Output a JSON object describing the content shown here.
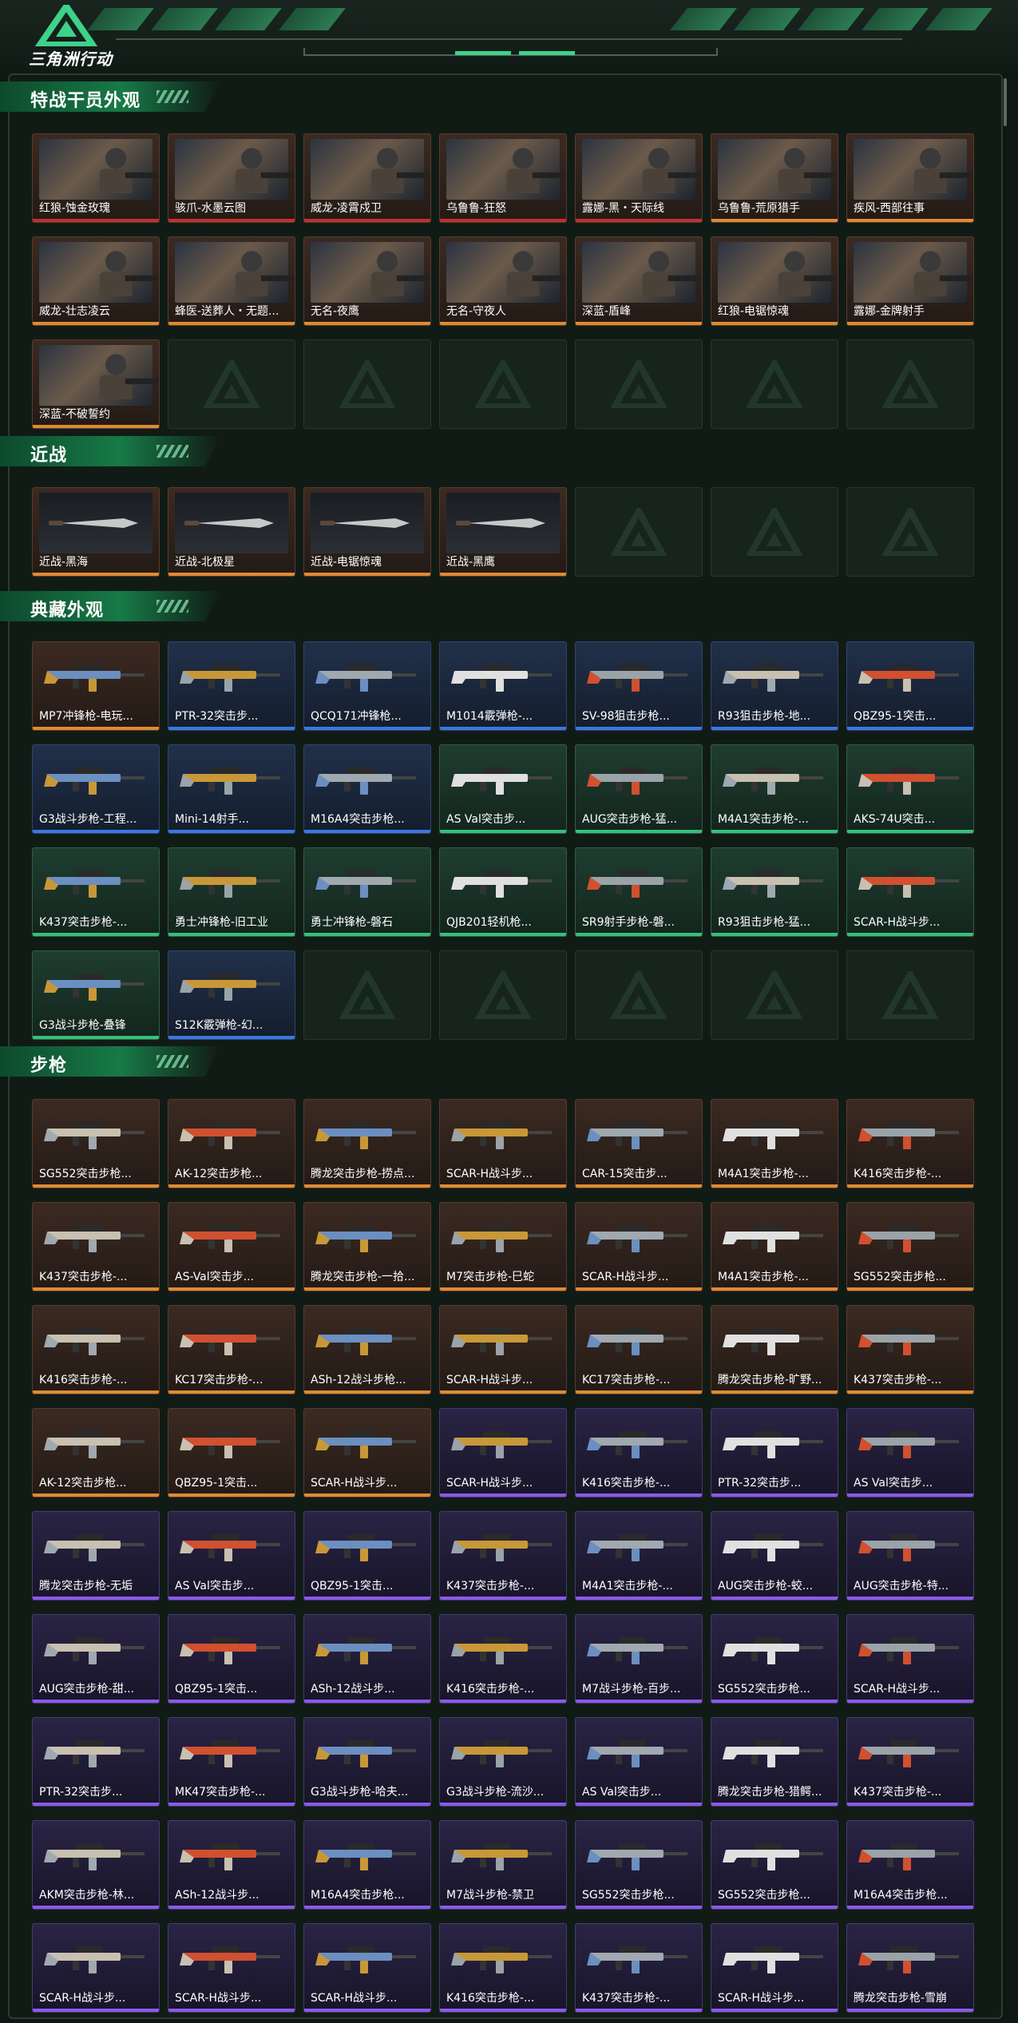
{
  "app": {
    "title": "三角洲行动"
  },
  "colors": {
    "accent": "#36c07a",
    "bg": "#0e1712",
    "legendary": "#e08a32",
    "epic": "#8a5ae8",
    "rare": "#3a78e0",
    "uncommon": "#36c07a",
    "red": "#c03030"
  },
  "sections": [
    {
      "title": "特战干员外观",
      "kind": "agent",
      "items": [
        {
          "label": "红狼-蚀金玫瑰",
          "rarity": "red"
        },
        {
          "label": "骇爪-水墨云图",
          "rarity": "red"
        },
        {
          "label": "威龙-凌霄戍卫",
          "rarity": "red"
        },
        {
          "label": "乌鲁鲁-狂怒",
          "rarity": "red"
        },
        {
          "label": "露娜-黑・天际线",
          "rarity": "red"
        },
        {
          "label": "乌鲁鲁-荒原猎手",
          "rarity": "orange"
        },
        {
          "label": "疾风-西部往事",
          "rarity": "orange"
        },
        {
          "label": "威龙-壮志凌云",
          "rarity": "orange"
        },
        {
          "label": "蜂医-送葬人・无题...",
          "rarity": "orange"
        },
        {
          "label": "无名-夜鹰",
          "rarity": "orange"
        },
        {
          "label": "无名-守夜人",
          "rarity": "orange"
        },
        {
          "label": "深蓝-盾峰",
          "rarity": "orange"
        },
        {
          "label": "红狼-电锯惊魂",
          "rarity": "orange"
        },
        {
          "label": "露娜-金牌射手",
          "rarity": "orange"
        },
        {
          "label": "深蓝-不破誓约",
          "rarity": "orange"
        }
      ],
      "empty": 6
    },
    {
      "title": "近战",
      "kind": "melee",
      "items": [
        {
          "label": "近战-黑海",
          "rarity": "orange"
        },
        {
          "label": "近战-北极星",
          "rarity": "orange"
        },
        {
          "label": "近战-电锯惊魂",
          "rarity": "orange"
        },
        {
          "label": "近战-黑鹰",
          "rarity": "orange"
        }
      ],
      "empty": 3
    },
    {
      "title": "典藏外观",
      "kind": "gun",
      "items": [
        {
          "label": "MP7冲锋枪-电玩...",
          "rarity": "brown"
        },
        {
          "label": "PTR-32突击步...",
          "rarity": "blue"
        },
        {
          "label": "QCQ171冲锋枪...",
          "rarity": "blue"
        },
        {
          "label": "M1014霰弹枪-...",
          "rarity": "blue"
        },
        {
          "label": "SV-98狙击步枪...",
          "rarity": "blue"
        },
        {
          "label": "R93狙击步枪-地...",
          "rarity": "blue"
        },
        {
          "label": "QBZ95-1突击...",
          "rarity": "blue"
        },
        {
          "label": "G3战斗步枪-工程...",
          "rarity": "blue"
        },
        {
          "label": "Mini-14射手...",
          "rarity": "blue"
        },
        {
          "label": "M16A4突击步枪...",
          "rarity": "blue"
        },
        {
          "label": "AS Val突击步...",
          "rarity": "green"
        },
        {
          "label": "AUG突击步枪-猛...",
          "rarity": "green"
        },
        {
          "label": "M4A1突击步枪-...",
          "rarity": "green"
        },
        {
          "label": "AKS-74U突击...",
          "rarity": "green"
        },
        {
          "label": "K437突击步枪-...",
          "rarity": "green"
        },
        {
          "label": "勇士冲锋枪-旧工业",
          "rarity": "green"
        },
        {
          "label": "勇士冲锋枪-磐石",
          "rarity": "green"
        },
        {
          "label": "QJB201轻机枪...",
          "rarity": "green"
        },
        {
          "label": "SR9射手步枪-磐...",
          "rarity": "green"
        },
        {
          "label": "R93狙击步枪-猛...",
          "rarity": "green"
        },
        {
          "label": "SCAR-H战斗步...",
          "rarity": "green"
        },
        {
          "label": "G3战斗步枪-叠锋",
          "rarity": "green"
        },
        {
          "label": "S12K霰弹枪-幻...",
          "rarity": "blue"
        }
      ],
      "empty": 5
    },
    {
      "title": "步枪",
      "kind": "gun",
      "items": [
        {
          "label": "SG552突击步枪...",
          "rarity": "brown"
        },
        {
          "label": "AK-12突击步枪...",
          "rarity": "brown"
        },
        {
          "label": "腾龙突击步枪-捞点...",
          "rarity": "brown"
        },
        {
          "label": "SCAR-H战斗步...",
          "rarity": "brown"
        },
        {
          "label": "CAR-15突击步...",
          "rarity": "brown"
        },
        {
          "label": "M4A1突击步枪-...",
          "rarity": "brown"
        },
        {
          "label": "K416突击步枪-...",
          "rarity": "brown"
        },
        {
          "label": "K437突击步枪-...",
          "rarity": "brown"
        },
        {
          "label": "AS-Val突击步...",
          "rarity": "brown"
        },
        {
          "label": "腾龙突击步枪-一拾...",
          "rarity": "brown"
        },
        {
          "label": "M7突击步枪-巳蛇",
          "rarity": "brown"
        },
        {
          "label": "SCAR-H战斗步...",
          "rarity": "brown"
        },
        {
          "label": "M4A1突击步枪-...",
          "rarity": "brown"
        },
        {
          "label": "SG552突击步枪...",
          "rarity": "brown"
        },
        {
          "label": "K416突击步枪-...",
          "rarity": "brown"
        },
        {
          "label": "KC17突击步枪-...",
          "rarity": "brown"
        },
        {
          "label": "ASh-12战斗步枪...",
          "rarity": "brown"
        },
        {
          "label": "SCAR-H战斗步...",
          "rarity": "brown"
        },
        {
          "label": "KC17突击步枪-...",
          "rarity": "brown"
        },
        {
          "label": "腾龙突击步枪-旷野...",
          "rarity": "brown"
        },
        {
          "label": "K437突击步枪-...",
          "rarity": "brown"
        },
        {
          "label": "AK-12突击步枪...",
          "rarity": "brown"
        },
        {
          "label": "QBZ95-1突击...",
          "rarity": "brown"
        },
        {
          "label": "SCAR-H战斗步...",
          "rarity": "brown"
        },
        {
          "label": "SCAR-H战斗步...",
          "rarity": "purple"
        },
        {
          "label": "K416突击步枪-...",
          "rarity": "purple"
        },
        {
          "label": "PTR-32突击步...",
          "rarity": "purple"
        },
        {
          "label": "AS Val突击步...",
          "rarity": "purple"
        },
        {
          "label": "腾龙突击步枪-无垢",
          "rarity": "purple"
        },
        {
          "label": "AS Val突击步...",
          "rarity": "purple"
        },
        {
          "label": "QBZ95-1突击...",
          "rarity": "purple"
        },
        {
          "label": "K437突击步枪-...",
          "rarity": "purple"
        },
        {
          "label": "M4A1突击步枪-...",
          "rarity": "purple"
        },
        {
          "label": "AUG突击步枪-蛟...",
          "rarity": "purple"
        },
        {
          "label": "AUG突击步枪-特...",
          "rarity": "purple"
        },
        {
          "label": "AUG突击步枪-甜...",
          "rarity": "purple"
        },
        {
          "label": "QBZ95-1突击...",
          "rarity": "purple"
        },
        {
          "label": "ASh-12战斗步...",
          "rarity": "purple"
        },
        {
          "label": "K416突击步枪-...",
          "rarity": "purple"
        },
        {
          "label": "M7战斗步枪-百步...",
          "rarity": "purple"
        },
        {
          "label": "SG552突击步枪...",
          "rarity": "purple"
        },
        {
          "label": "SCAR-H战斗步...",
          "rarity": "purple"
        },
        {
          "label": "PTR-32突击步...",
          "rarity": "purple"
        },
        {
          "label": "MK47突击步枪-...",
          "rarity": "purple"
        },
        {
          "label": "G3战斗步枪-哈夫...",
          "rarity": "purple"
        },
        {
          "label": "G3战斗步枪-流沙...",
          "rarity": "purple"
        },
        {
          "label": "AS Val突击步...",
          "rarity": "purple"
        },
        {
          "label": "腾龙突击步枪-猎鳄...",
          "rarity": "purple"
        },
        {
          "label": "K437突击步枪-...",
          "rarity": "purple"
        },
        {
          "label": "AKM突击步枪-林...",
          "rarity": "purple"
        },
        {
          "label": "ASh-12战斗步...",
          "rarity": "purple"
        },
        {
          "label": "M16A4突击步枪...",
          "rarity": "purple"
        },
        {
          "label": "M7战斗步枪-禁卫",
          "rarity": "purple"
        },
        {
          "label": "SG552突击步枪...",
          "rarity": "purple"
        },
        {
          "label": "SG552突击步枪...",
          "rarity": "purple"
        },
        {
          "label": "M16A4突击步枪...",
          "rarity": "purple"
        },
        {
          "label": "SCAR-H战斗步...",
          "rarity": "purple"
        },
        {
          "label": "SCAR-H战斗步...",
          "rarity": "purple"
        },
        {
          "label": "SCAR-H战斗步...",
          "rarity": "purple"
        },
        {
          "label": "K416突击步枪-...",
          "rarity": "purple"
        },
        {
          "label": "K437突击步枪-...",
          "rarity": "purple"
        },
        {
          "label": "SCAR-H战斗步...",
          "rarity": "purple"
        },
        {
          "label": "腾龙突击步枪-雪崩",
          "rarity": "purple"
        }
      ],
      "empty": 0
    }
  ]
}
